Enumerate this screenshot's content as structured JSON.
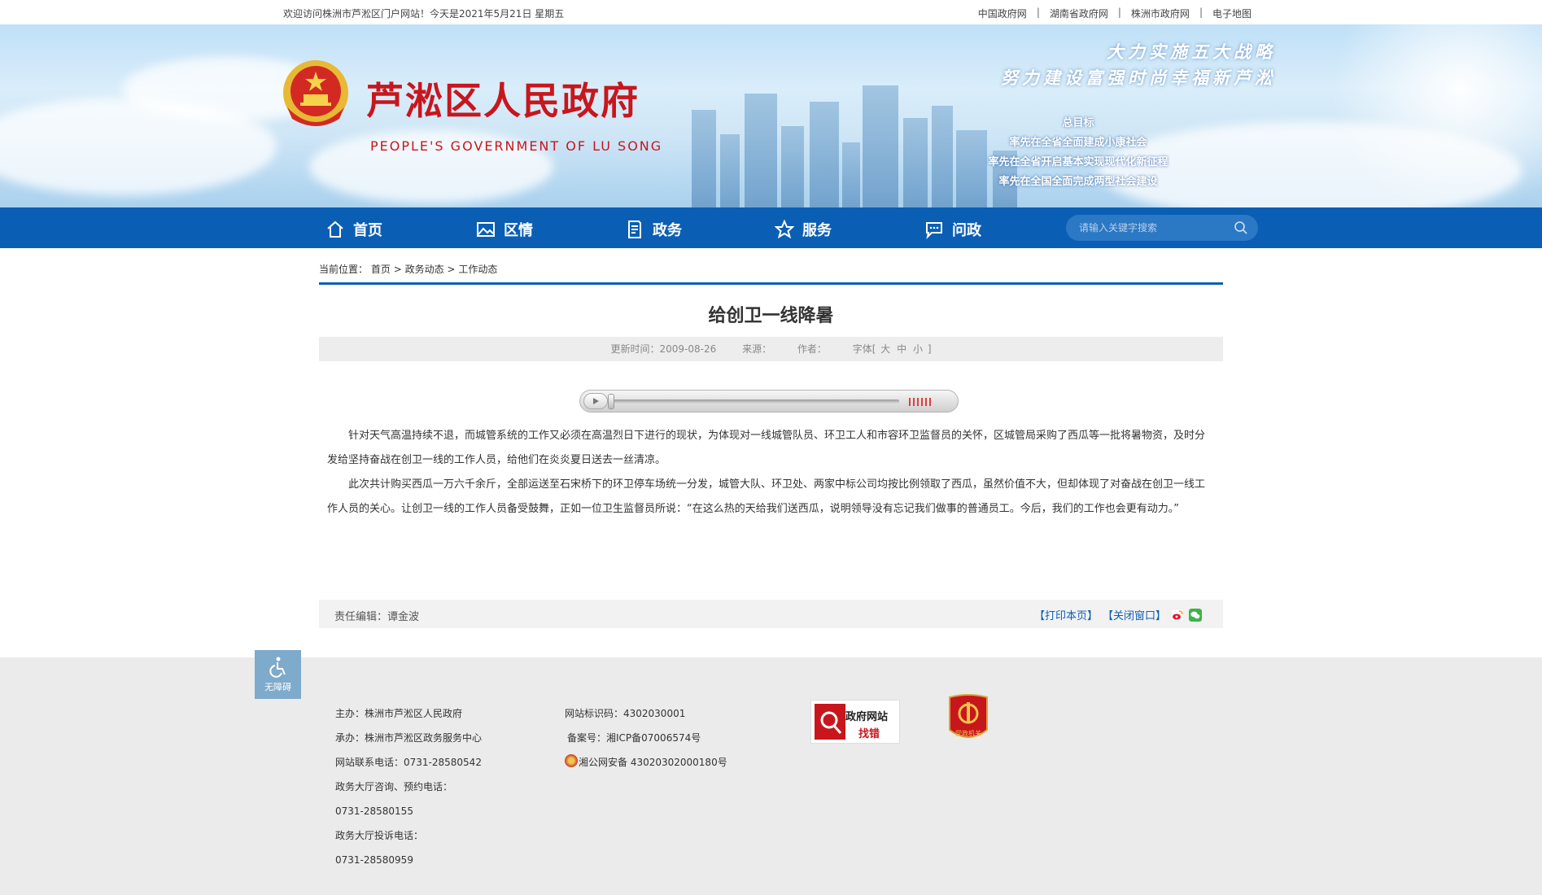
{
  "topbar": {
    "welcome": "欢迎访问株洲市芦淞区门户网站！今天是2021年5月21日 星期五",
    "links": [
      "中国政府网",
      "湖南省政府网",
      "株洲市政府网",
      "电子地图"
    ],
    "separator": "|"
  },
  "header": {
    "title": "芦淞区人民政府",
    "subtitle": "PEOPLE'S GOVERNMENT OF  LU SONG",
    "slogan_line1": "大力实施五大战略",
    "slogan_line2": "努力建设富强时尚幸福新芦淞",
    "goals_title": "总目标",
    "goals": [
      "率先在全省全面建成小康社会",
      "率先在全省开启基本实现现代化新征程",
      "率先在全国全面完成两型社会建设"
    ]
  },
  "nav": {
    "items": [
      {
        "label": "首页",
        "icon": "home-icon"
      },
      {
        "label": "区情",
        "icon": "picture-icon"
      },
      {
        "label": "政务",
        "icon": "document-icon"
      },
      {
        "label": "服务",
        "icon": "star-icon"
      },
      {
        "label": "问政",
        "icon": "chat-icon"
      }
    ],
    "search_placeholder": "请输入关键字搜索"
  },
  "breadcrumb": {
    "prefix": "当前位置：",
    "items": [
      "首页",
      "政务动态",
      "工作动态"
    ],
    "sep": ">"
  },
  "article": {
    "title": "给创卫一线降暑",
    "updated_label": "更新时间：",
    "updated": "2009-08-26",
    "source_label": "来源：",
    "author_label": "作者：",
    "font_size_label": "字体[",
    "font_sizes": [
      "大",
      "中",
      "小"
    ],
    "font_size_close": "]",
    "paragraphs": [
      "针对天气高温持续不退，而城管系统的工作又必须在高温烈日下进行的现状，为体现对一线城管队员、环卫工人和市容环卫监督员的关怀，区城管局采购了西瓜等一批将暑物资，及时分发给坚持奋战在创卫一线的工作人员，给他们在炎炎夏日送去一丝清凉。",
      "此次共计购买西瓜一万六千余斤，全部运送至石宋桥下的环卫停车场统一分发，城管大队、环卫处、两家中标公司均按比例领取了西瓜，虽然价值不大，但却体现了对奋战在创卫一线工作人员的关心。让创卫一线的工作人员备受鼓舞，正如一位卫生监督员所说：“在这么热的天给我们送西瓜，说明领导没有忘记我们做事的普通员工。今后，我们的工作也会更有动力。”"
    ],
    "editor_label": "责任编辑：",
    "editor": "谭金波",
    "print": "【打印本页】",
    "close": "【关闭窗口】"
  },
  "footer": {
    "a11y": "无障碍",
    "host": "主办：株洲市芦淞区人民政府",
    "organizer": "承办：株洲市芦淞区政务服务中心",
    "contact": "网站联系电话：0731-28580542",
    "consult_label": "政务大厅咨询、预约电话：",
    "consult_phone": "0731-28580155",
    "complaint_label": "政务大厅投诉电话：",
    "complaint_phone": "0731-28580959",
    "site_id": "网站标识码：4302030001",
    "icp": "备案号：湘ICP备07006574号",
    "police": "湘公网安备 43020302000180号",
    "badge_find_line1": "政府网站",
    "badge_find_line2": "找错",
    "badge_party": "党政机关"
  },
  "colors": {
    "nav_blue": "#0a5fb4",
    "title_red": "#c8161d"
  }
}
